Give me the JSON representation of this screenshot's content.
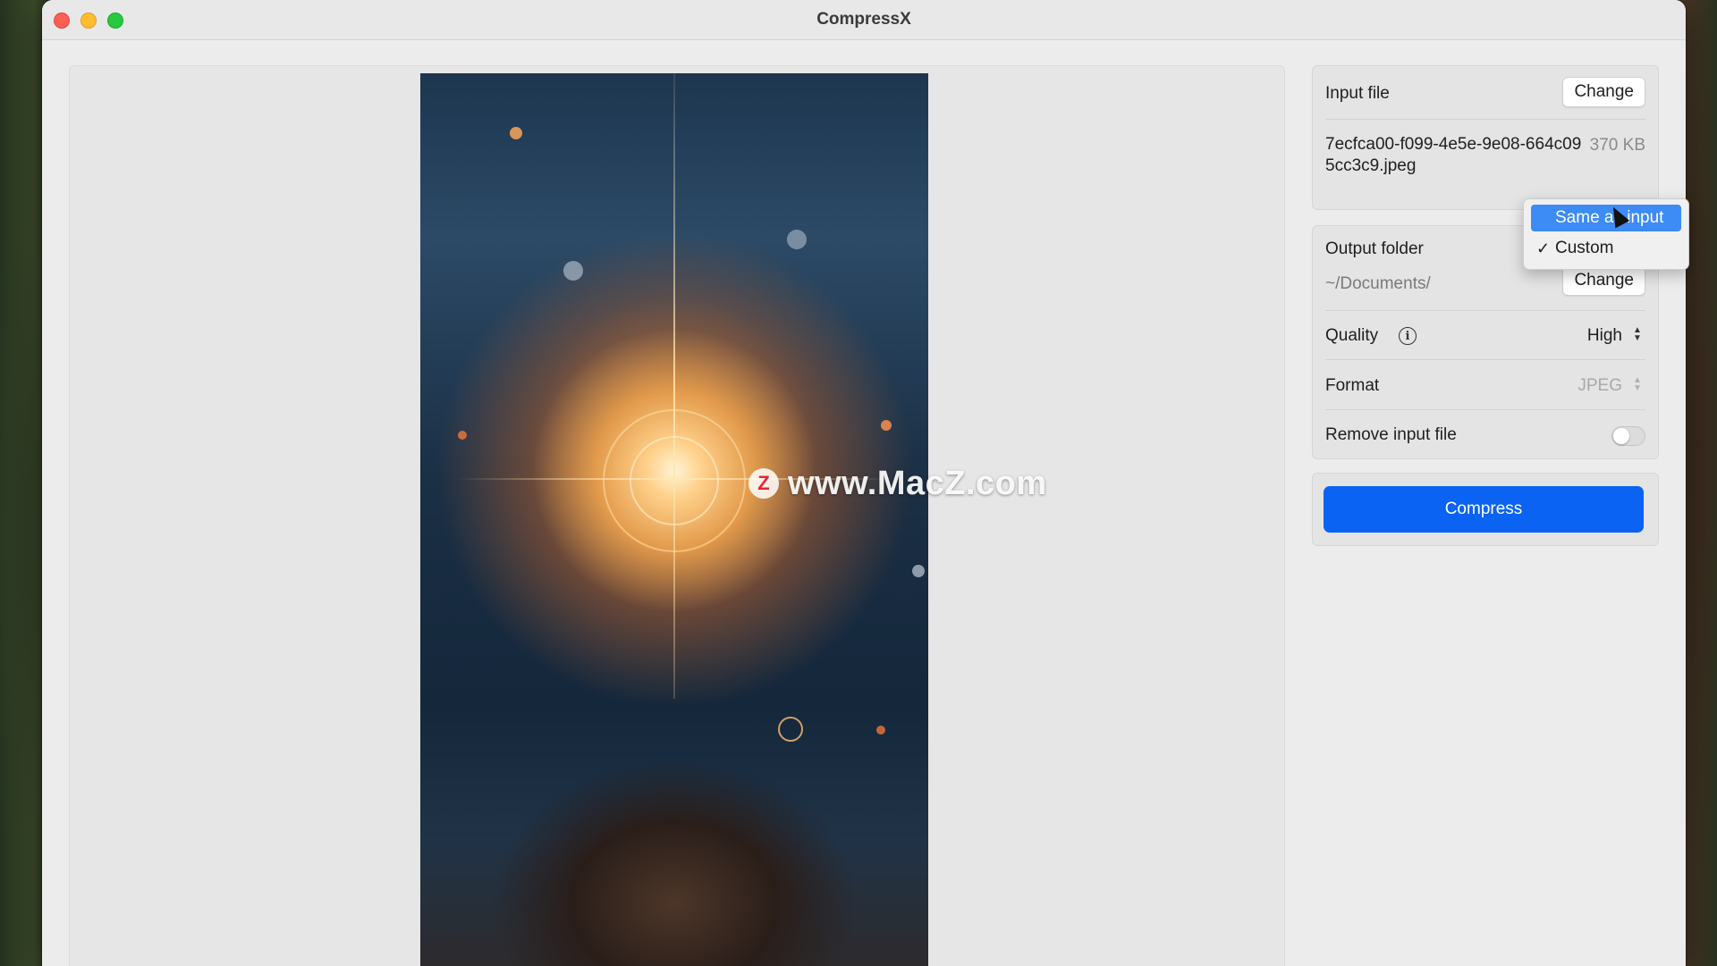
{
  "window": {
    "title": "CompressX"
  },
  "preview": {
    "watermark_badge": "Z",
    "watermark_text": "www.MacZ.com"
  },
  "input_card": {
    "label": "Input file",
    "change_label": "Change",
    "filename": "7ecfca00-f099-4e5e-9e08-664c095cc3c9.jpeg",
    "filesize": "370 KB"
  },
  "options": {
    "output_folder_label": "Output folder",
    "output_path": "~/Documents/",
    "change_label": "Change",
    "quality_label": "Quality",
    "quality_value": "High",
    "format_label": "Format",
    "format_value": "JPEG",
    "remove_input_label": "Remove input file",
    "remove_input_on": false
  },
  "action": {
    "compress_label": "Compress"
  },
  "output_menu": {
    "items": [
      {
        "label": "Same as input",
        "highlighted": true,
        "checked": false
      },
      {
        "label": "Custom",
        "highlighted": false,
        "checked": true
      }
    ],
    "check_glyph": "✓"
  },
  "colors": {
    "accent": "#0a63f2",
    "menu_highlight": "#3d8bf5"
  }
}
